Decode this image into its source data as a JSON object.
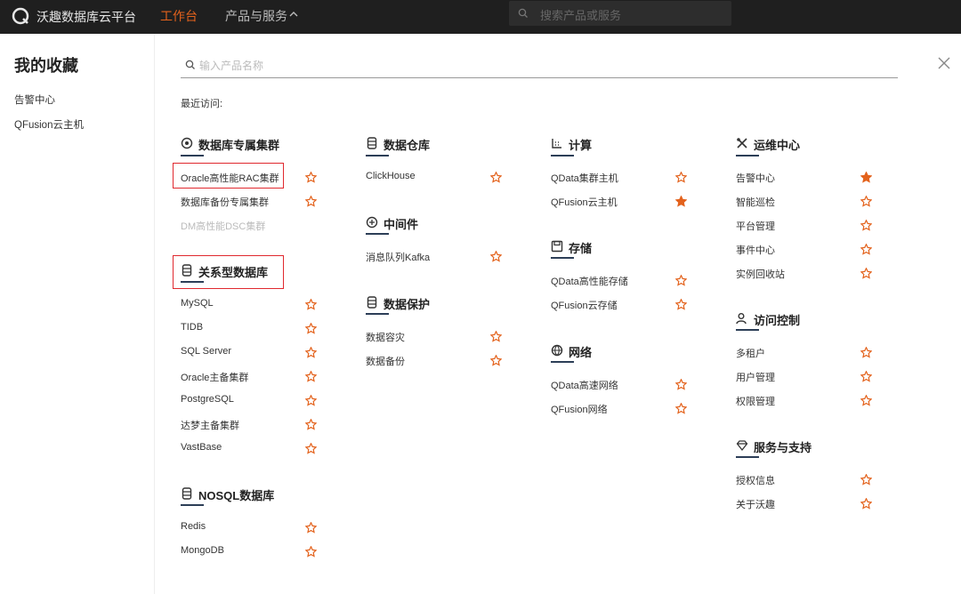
{
  "topbar": {
    "brand": "沃趣数据库云平台",
    "nav_workspace": "工作台",
    "nav_products": "产品与服务",
    "search_placeholder": "搜索产品或服务"
  },
  "sidebar": {
    "title": "我的收藏",
    "items": [
      "告警中心",
      "QFusion云主机"
    ]
  },
  "main": {
    "search_placeholder": "输入产品名称",
    "recent_label": "最近访问:",
    "sections": {
      "db_cluster": {
        "title": "数据库专属集群",
        "items": [
          "Oracle高性能RAC集群",
          "数据库备份专属集群",
          "DM高性能DSC集群"
        ]
      },
      "relational": {
        "title": "关系型数据库",
        "items": [
          "MySQL",
          "TIDB",
          "SQL Server",
          "Oracle主备集群",
          "PostgreSQL",
          "达梦主备集群",
          "VastBase"
        ]
      },
      "nosql": {
        "title": "NOSQL数据库",
        "items": [
          "Redis",
          "MongoDB"
        ]
      },
      "warehouse": {
        "title": "数据仓库",
        "items": [
          "ClickHouse"
        ]
      },
      "middleware": {
        "title": "中间件",
        "items": [
          "消息队列Kafka"
        ]
      },
      "protection": {
        "title": "数据保护",
        "items": [
          "数据容灾",
          "数据备份"
        ]
      },
      "compute": {
        "title": "计算",
        "items": [
          "QData集群主机",
          "QFusion云主机"
        ]
      },
      "storage": {
        "title": "存储",
        "items": [
          "QData高性能存储",
          "QFusion云存储"
        ]
      },
      "network": {
        "title": "网络",
        "items": [
          "QData高速网络",
          "QFusion网络"
        ]
      },
      "ops": {
        "title": "运维中心",
        "items": [
          "告警中心",
          "智能巡检",
          "平台管理",
          "事件中心",
          "实例回收站"
        ]
      },
      "access": {
        "title": "访问控制",
        "items": [
          "多租户",
          "用户管理",
          "权限管理"
        ]
      },
      "support": {
        "title": "服务与支持",
        "items": [
          "授权信息",
          "关于沃趣"
        ]
      }
    }
  },
  "colors": {
    "accent": "#e3621c",
    "highlight_border": "#e0282e",
    "topbar_bg": "#1f1f1f",
    "underline": "#2c3e57"
  },
  "favorited": [
    "QFusion云主机",
    "告警中心"
  ]
}
